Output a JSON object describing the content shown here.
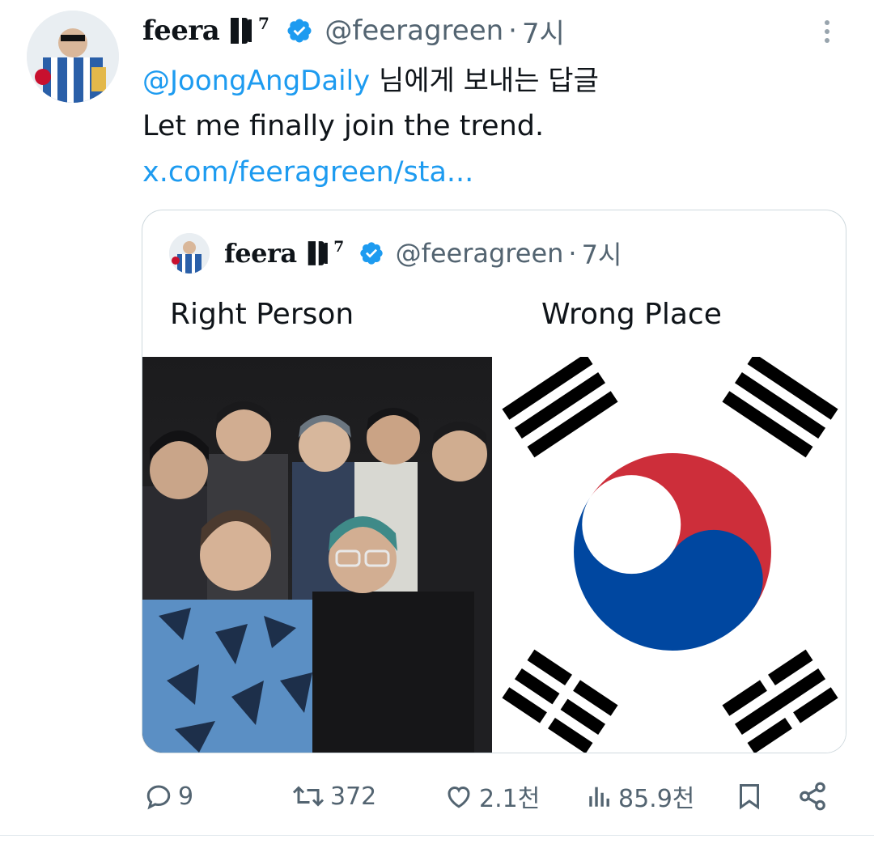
{
  "tweet": {
    "author_name": "feera",
    "author_mark": "ꟷ",
    "author_mark_text": "⟧⁷",
    "handle": "@feeragreen",
    "separator": "·",
    "time": "7시",
    "reply_mention": "@JoongAngDaily",
    "reply_rest": " 님에게 보내는 답글",
    "text": "Let me finally join the trend.",
    "link": "x.com/feeragreen/sta..."
  },
  "quote": {
    "author_name": "feera",
    "handle": "@feeragreen",
    "separator": "·",
    "time": "7시",
    "caption_left": "Right Person",
    "caption_right": "Wrong Place"
  },
  "actions": {
    "replies": "9",
    "retweets": "372",
    "likes": "2.1천",
    "views": "85.9천"
  },
  "colors": {
    "link": "#1d9bf0",
    "muted": "#536471",
    "verified": "#1d9bf0",
    "flag_red": "#cd2e3a",
    "flag_blue": "#0047a0"
  },
  "icons": [
    "verified-badge-icon",
    "more-icon",
    "reply-icon",
    "retweet-icon",
    "like-icon",
    "views-icon",
    "bookmark-icon",
    "share-icon"
  ]
}
